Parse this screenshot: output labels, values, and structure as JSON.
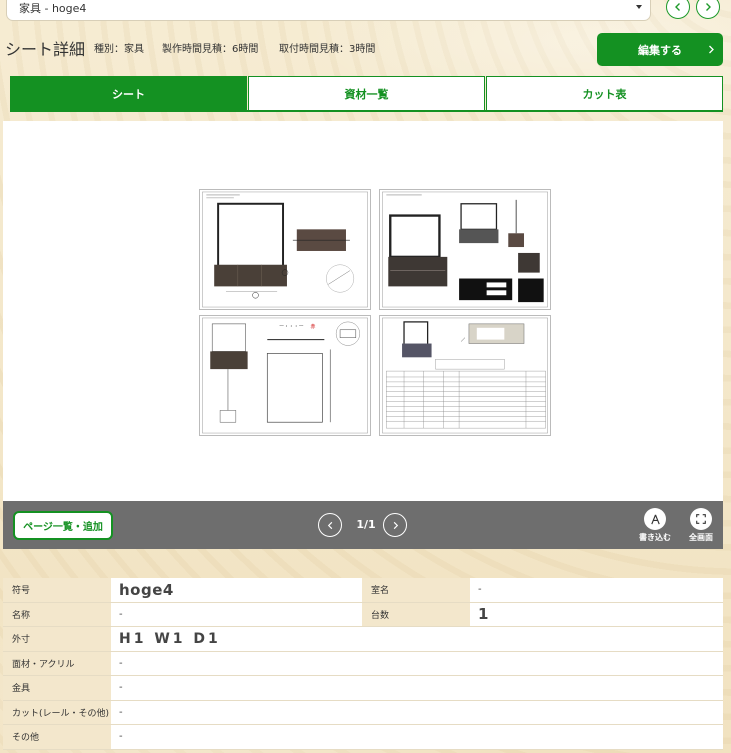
{
  "top_select": {
    "value": "家具 - hoge4"
  },
  "header": {
    "title": "シート詳細",
    "category": "種別：家具",
    "production_time": "製作時間見積：6時間",
    "install_time": "取付時間見積：3時間",
    "edit_label": "編集する"
  },
  "tabs": [
    {
      "label": "シート"
    },
    {
      "label": "資材一覧"
    },
    {
      "label": "カット表"
    }
  ],
  "viewer": {
    "page_list_label": "ページ一覧・追加",
    "page_count": "1/1",
    "write_label": "書き込む",
    "fullscreen_label": "全画面"
  },
  "details": {
    "symbol_label": "符号",
    "symbol_value": "hoge4",
    "room_label": "室名",
    "room_value": "-",
    "name_label": "名称",
    "name_value": "-",
    "count_label": "台数",
    "count_value": "1",
    "size_label": "外寸",
    "size_value": "H1 W1 D1",
    "face_label": "面材・アクリル",
    "face_value": "-",
    "hardware_label": "金具",
    "hardware_value": "-",
    "cut_label": "カット(レール・その他)",
    "cut_value": "-",
    "other_label": "その他",
    "other_value": "-"
  },
  "colors": {
    "accent": "#149122",
    "bar": "#6e6e6e"
  }
}
